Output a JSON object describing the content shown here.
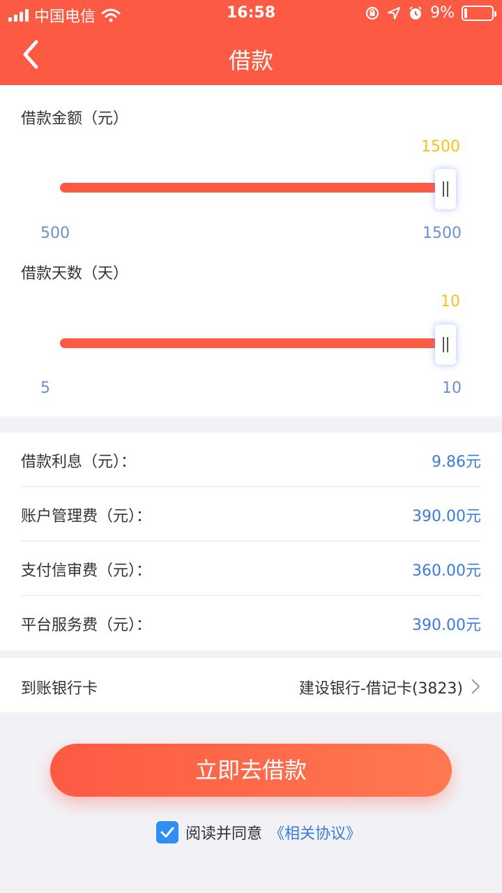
{
  "status_bar": {
    "carrier": "中国电信",
    "time": "16:58",
    "battery": "9%"
  },
  "nav": {
    "title": "借款"
  },
  "amount_slider": {
    "label": "借款金额（元）",
    "value_text": "1500",
    "min_text": "500",
    "max_text": "1500",
    "value": 1500,
    "min": 500,
    "max": 1500
  },
  "days_slider": {
    "label": "借款天数（天）",
    "value_text": "10",
    "min_text": "5",
    "max_text": "10",
    "value": 10,
    "min": 5,
    "max": 10
  },
  "fees": [
    {
      "label": "借款利息（元）：",
      "value": "9.86元"
    },
    {
      "label": "账户管理费（元）：",
      "value": "390.00元"
    },
    {
      "label": "支付信审费（元）：",
      "value": "360.00元"
    },
    {
      "label": "平台服务费（元）：",
      "value": "390.00元"
    }
  ],
  "bank": {
    "label": "到账银行卡",
    "value": "建设银行-借记卡(3823)"
  },
  "cta": {
    "label": "立即去借款"
  },
  "agreement": {
    "checked": true,
    "text": "阅读并同意",
    "link": "《相关协议》"
  },
  "colors": {
    "brand": "#fd5a43",
    "accent_blue": "#3a7be0",
    "value_yellow": "#f5c218"
  }
}
